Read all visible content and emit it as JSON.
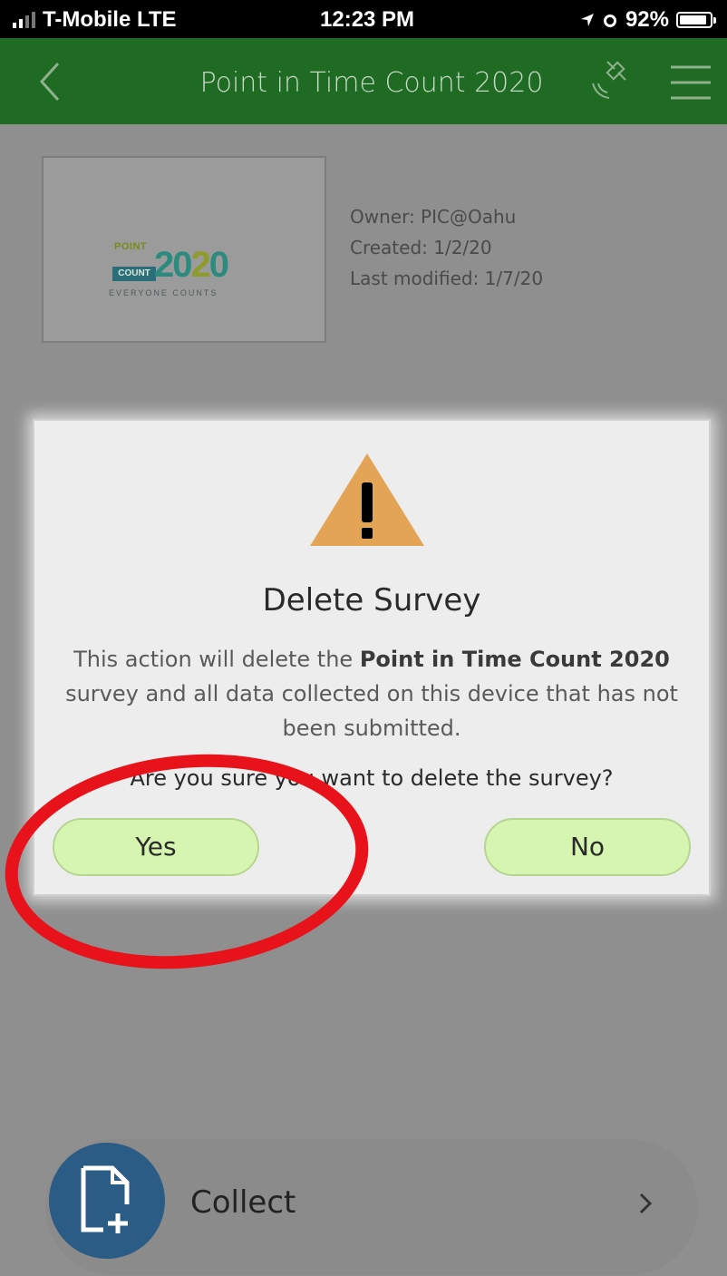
{
  "status_bar": {
    "carrier": "T-Mobile  LTE",
    "time": "12:23 PM",
    "battery": "92%",
    "battery_level": 0.92
  },
  "header": {
    "title": "Point in Time Count 2020",
    "back_icon": "chevron-left-icon",
    "satellite_icon": "satellite-icon",
    "menu_icon": "hamburger-menu-icon",
    "color": "#1f6b24"
  },
  "survey": {
    "logo": {
      "word_top": "POINT",
      "word_count": "COUNT",
      "year_a": "20",
      "year_b": "2",
      "year_c": "0",
      "tagline": "EVERYONE COUNTS"
    },
    "owner": "Owner: PIC@Oahu",
    "created": "Created: 1/2/20",
    "modified": "Last modified: 1/7/20"
  },
  "dialog": {
    "icon": "warning-icon",
    "title": "Delete Survey",
    "body_prefix": "This action will delete the ",
    "body_bold": "Point in Time Count 2020",
    "body_suffix": " survey and all data collected on this device that has not been submitted.",
    "question": "Are you sure you want to delete the survey?",
    "yes_label": "Yes",
    "no_label": "No",
    "button_color": "#d6f5b0"
  },
  "collect": {
    "label": "Collect",
    "icon": "add-document-icon",
    "chevron_icon": "chevron-right-icon",
    "icon_color": "#2b5c86"
  },
  "annotation": {
    "color": "#e8121b"
  }
}
